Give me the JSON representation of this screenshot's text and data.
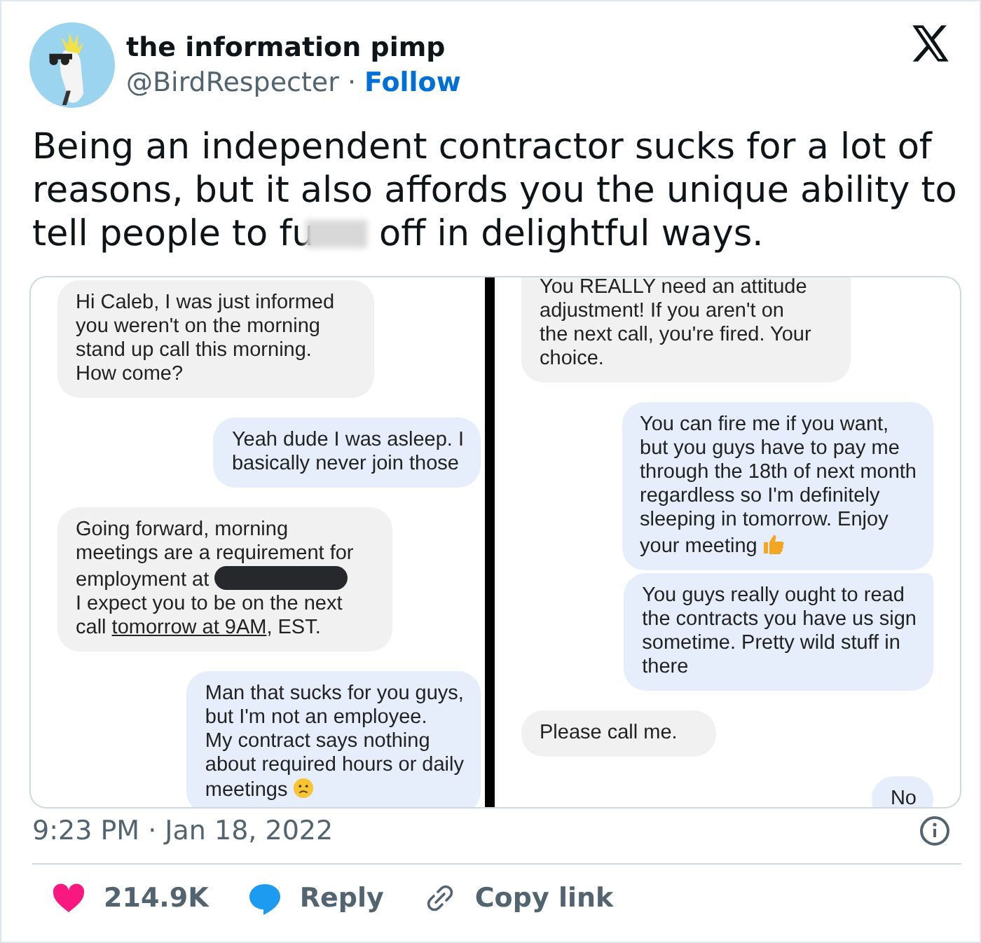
{
  "author": {
    "name": "the information pimp",
    "handle": "@BirdRespecter",
    "separator": "·",
    "follow": "Follow"
  },
  "tweet": {
    "segments": [
      {
        "kind": "text",
        "text": "Being an independent contractor sucks for a lot of reasons, but it also affords you the unique ability to tell people to fu"
      },
      {
        "kind": "blur"
      },
      {
        "kind": "text",
        "text": " off in delightful ways."
      }
    ]
  },
  "chat_screenshot": {
    "panels": [
      {
        "messages": [
          {
            "kind": "incoming",
            "joined": false,
            "clipped": false,
            "segments": [
              {
                "kind": "text",
                "text": "Hi Caleb, I was just informed\nyou weren't on the morning\nstand up call this morning.\nHow come?"
              }
            ]
          },
          {
            "kind": "outgoing",
            "joined": false,
            "clipped": false,
            "segments": [
              {
                "kind": "text",
                "text": "Yeah dude I was asleep. I\nbasically never join those"
              }
            ]
          },
          {
            "kind": "incoming",
            "joined": false,
            "clipped": false,
            "segments": [
              {
                "kind": "text",
                "text": "Going forward, morning\nmeetings are a requirement for\nemployment at "
              },
              {
                "kind": "redacted"
              },
              {
                "kind": "text",
                "text": "\nI expect you to be on the next\ncall "
              },
              {
                "kind": "link",
                "text": "tomorrow at 9AM"
              },
              {
                "kind": "text",
                "text": ", EST."
              }
            ]
          },
          {
            "kind": "outgoing",
            "joined": false,
            "clipped": false,
            "segments": [
              {
                "kind": "text",
                "text": "Man that sucks for you guys,\nbut I'm not an employee.\nMy contract says nothing\nabout required hours or daily\nmeetings "
              },
              {
                "kind": "sad-emoji"
              }
            ]
          }
        ]
      },
      {
        "messages": [
          {
            "kind": "incoming",
            "joined": false,
            "clipped": true,
            "segments": [
              {
                "kind": "text",
                "text": "You REALLY need an attitude\nadjustment! If you aren't on\nthe next call, you're fired. Your\nchoice."
              }
            ]
          },
          {
            "kind": "outgoing",
            "joined": false,
            "clipped": false,
            "segments": [
              {
                "kind": "text",
                "text": "You can fire me if you want,\nbut you guys have to pay me\nthrough the 18th of next month\nregardless so I'm definitely\nsleeping in tomorrow. Enjoy\nyour meeting "
              },
              {
                "kind": "thumbs-up-emoji"
              }
            ]
          },
          {
            "kind": "outgoing",
            "joined": true,
            "clipped": false,
            "segments": [
              {
                "kind": "text",
                "text": "You guys really ought to read\nthe contracts you have us sign\nsometime. Pretty wild stuff in\nthere"
              }
            ]
          },
          {
            "kind": "incoming",
            "joined": false,
            "clipped": false,
            "segments": [
              {
                "kind": "text",
                "text": "Please call me."
              }
            ]
          },
          {
            "kind": "outgoing",
            "joined": false,
            "clipped": false,
            "segments": [
              {
                "kind": "text",
                "text": "No"
              }
            ]
          }
        ]
      }
    ]
  },
  "timestamp": "9:23 PM · Jan 18, 2022",
  "actions": [
    {
      "kind": "like",
      "label": "214.9K"
    },
    {
      "kind": "reply",
      "label": "Reply"
    },
    {
      "kind": "copy",
      "label": "Copy link"
    }
  ]
}
